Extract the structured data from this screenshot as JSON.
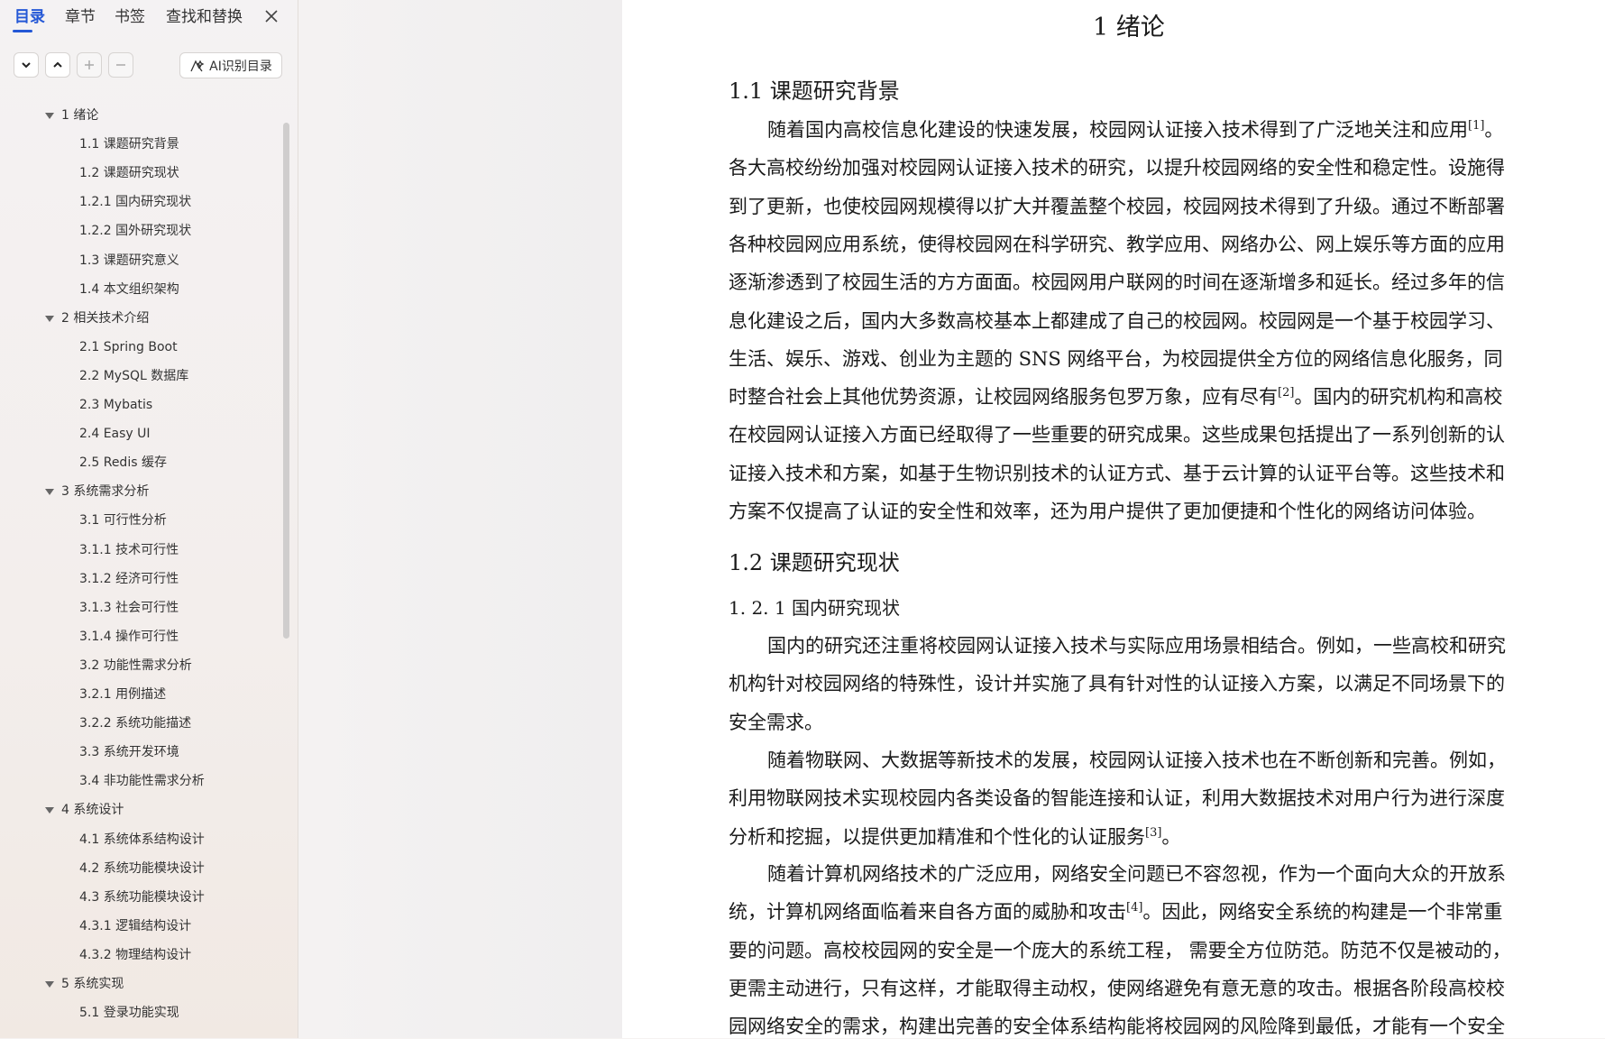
{
  "tabs": [
    "目录",
    "章节",
    "书签",
    "查找和替换"
  ],
  "toolbar": {
    "ai_button": "AI识别目录"
  },
  "toc": [
    {
      "label": "1  绪论",
      "level": 1
    },
    {
      "label": "1.1  课题研究背景",
      "level": 2
    },
    {
      "label": "1.2  课题研究现状",
      "level": 2
    },
    {
      "label": "1.2.1  国内研究现状",
      "level": 2
    },
    {
      "label": "1.2.2  国外研究现状",
      "level": 2
    },
    {
      "label": "1.3  课题研究意义",
      "level": 2
    },
    {
      "label": "1.4  本文组织架构",
      "level": 2
    },
    {
      "label": "2  相关技术介绍",
      "level": 1
    },
    {
      "label": "2.1 Spring Boot",
      "level": 2
    },
    {
      "label": "2.2 MySQL 数据库",
      "level": 2
    },
    {
      "label": "2.3 Mybatis",
      "level": 2
    },
    {
      "label": "2.4 Easy UI",
      "level": 2
    },
    {
      "label": "2.5 Redis  缓存",
      "level": 2
    },
    {
      "label": "3  系统需求分析",
      "level": 1
    },
    {
      "label": "3.1  可行性分析",
      "level": 2
    },
    {
      "label": "3.1.1  技术可行性",
      "level": 2
    },
    {
      "label": "3.1.2  经济可行性",
      "level": 2
    },
    {
      "label": "3.1.3  社会可行性",
      "level": 2
    },
    {
      "label": "3.1.4  操作可行性",
      "level": 2
    },
    {
      "label": "3.2  功能性需求分析",
      "level": 2
    },
    {
      "label": "3.2.1  用例描述",
      "level": 2
    },
    {
      "label": "3.2.2  系统功能描述",
      "level": 2
    },
    {
      "label": "3.3  系统开发环境",
      "level": 2
    },
    {
      "label": "3.4  非功能性需求分析",
      "level": 2
    },
    {
      "label": "4  系统设计",
      "level": 1
    },
    {
      "label": "4.1  系统体系结构设计",
      "level": 2
    },
    {
      "label": "4.2  系统功能模块设计",
      "level": 2
    },
    {
      "label": "4.3  系统功能模块设计",
      "level": 2
    },
    {
      "label": "4.3.1  逻辑结构设计",
      "level": 2
    },
    {
      "label": "4.3.2  物理结构设计",
      "level": 2
    },
    {
      "label": "5  系统实现",
      "level": 1
    },
    {
      "label": "5.1  登录功能实现",
      "level": 2
    }
  ],
  "document": {
    "chapter_title": "1  绪论",
    "section_1_1": "1.1  课题研究背景",
    "p1": [
      {
        "text": "随着国内高校信息化建设的快速发展，校园网认证接入技术得到了广泛地关注和应用",
        "sup": "[1]",
        "after": "。"
      },
      {
        "text": "各大高校纷纷加强对校园网认证接入技术的研究，以提升校园网络的安全性和稳定性。设施得"
      },
      {
        "text": "到了更新，也使校园网规模得以扩大并覆盖整个校园，校园网技术得到了升级。通过不断部署"
      },
      {
        "text": "各种校园网应用系统，使得校园网在科学研究、教学应用、网络办公、网上娱乐等方面的应用"
      },
      {
        "text": "逐渐渗透到了校园生活的方方面面。校园网用户联网的时间在逐渐增多和延长。经过多年的信"
      },
      {
        "text": "息化建设之后，国内大多数高校基本上都建成了自己的校园网。校园网是一个基于校园学习、"
      },
      {
        "text": "生活、娱乐、游戏、创业为主题的 SNS 网络平台，为校园提供全方位的网络信息化服务，同"
      },
      {
        "text": "时整合社会上其他优势资源，让校园网络服务包罗万象，应有尽有",
        "sup": "[2]",
        "after": "。国内的研究机构和高校"
      },
      {
        "text": "在校园网认证接入方面已经取得了一些重要的研究成果。这些成果包括提出了一系列创新的认"
      },
      {
        "text": "证接入技术和方案，如基于生物识别技术的认证方式、基于云计算的认证平台等。这些技术和"
      },
      {
        "text": "方案不仅提高了认证的安全性和效率，还为用户提供了更加便捷和个性化的网络访问体验。"
      }
    ],
    "section_1_2": "1.2  课题研究现状",
    "section_1_2_1": "1. 2. 1  国内研究现状",
    "p2": [
      {
        "text": "国内的研究还注重将校园网认证接入技术与实际应用场景相结合。例如，一些高校和研究"
      },
      {
        "text": "机构针对校园网络的特殊性，设计并实施了具有针对性的认证接入方案，以满足不同场景下的"
      },
      {
        "text": "安全需求。"
      }
    ],
    "p3": [
      {
        "text": "随着物联网、大数据等新技术的发展，校园网认证接入技术也在不断创新和完善。例如，"
      },
      {
        "text": "利用物联网技术实现校园内各类设备的智能连接和认证，利用大数据技术对用户行为进行深度"
      },
      {
        "text": "分析和挖掘，以提供更加精准和个性化的认证服务",
        "sup": "[3]",
        "after": "。"
      }
    ],
    "p4": [
      {
        "text": "随着计算机网络技术的广泛应用，网络安全问题已不容忽视，作为一个面向大众的开放系"
      },
      {
        "text": "统，计算机网络面临着来自各方面的威胁和攻击",
        "sup": "[4]",
        "after": "。因此，网络安全系统的构建是一个非常重"
      },
      {
        "text": "要的问题。高校校园网的安全是一个庞大的系统工程，  需要全方位防范。防范不仅是被动的，"
      },
      {
        "text": "更需主动进行，只有这样，才能取得主动权，使网络避免有意无意的攻击。根据各阶段高校校"
      },
      {
        "text": "园网络安全的需求，构建出完善的安全体系结构能将校园网的风险降到最低，才能有一个安全"
      }
    ]
  },
  "colors": {
    "accent": "#2458d6",
    "text": "#1a1a1a",
    "nav_bg": "#f4f1f0"
  }
}
